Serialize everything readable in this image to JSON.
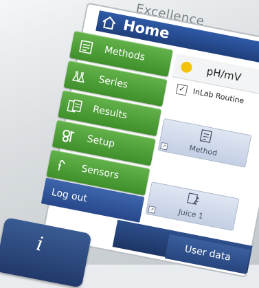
{
  "brand": "Excellence",
  "header": {
    "title": "Home"
  },
  "menu": [
    {
      "label": "Methods",
      "icon": "methods-icon"
    },
    {
      "label": "Series",
      "icon": "series-icon"
    },
    {
      "label": "Results",
      "icon": "results-icon"
    },
    {
      "label": "Setup",
      "icon": "setup-icon"
    },
    {
      "label": "Sensors",
      "icon": "sensors-icon"
    }
  ],
  "logout_label": "Log out",
  "status": {
    "value": "pH/mV",
    "indicator_color": "#f2c30a"
  },
  "sensor": {
    "name": "InLab Routine",
    "checked": true
  },
  "shortcuts": [
    {
      "label": "Method",
      "icon": "method-shortcut-icon"
    },
    {
      "label": "Juice 1",
      "icon": "runner-icon"
    }
  ],
  "user_data_label": "User data",
  "info_label": "i",
  "colors": {
    "accent": "#1f3f7c",
    "menu_green": "#4a9a34",
    "indicator": "#f2c30a"
  }
}
